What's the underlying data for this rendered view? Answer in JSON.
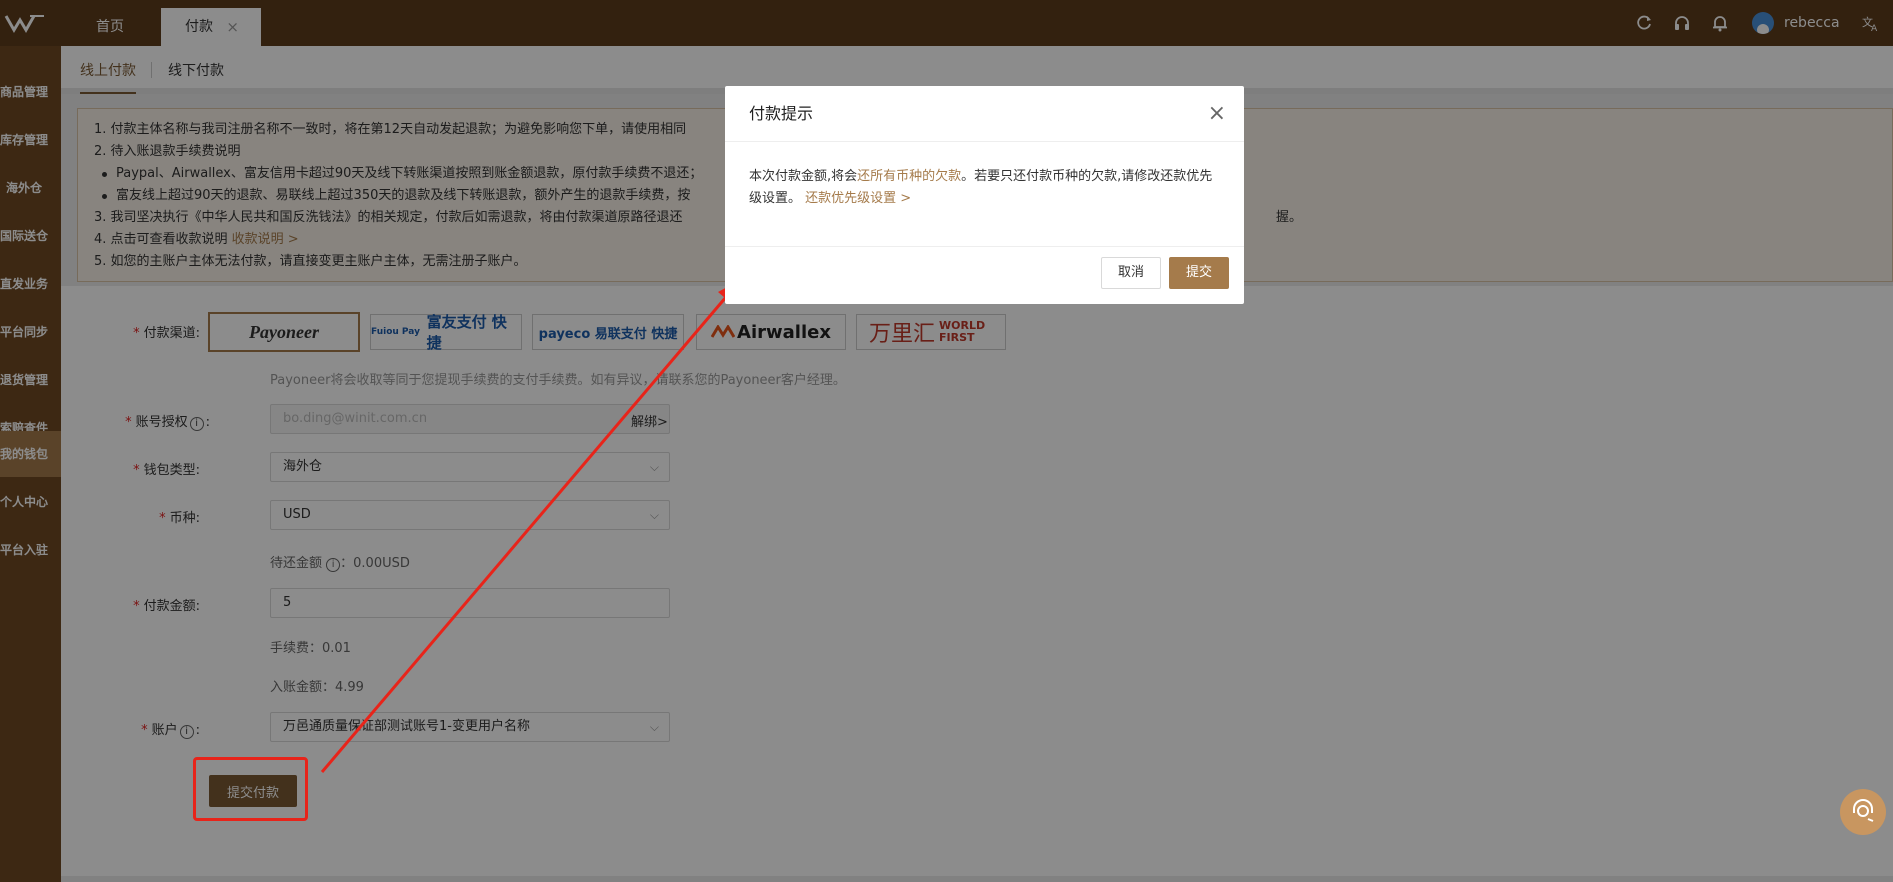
{
  "header": {
    "tabs": [
      {
        "label": "首页"
      },
      {
        "label": "付款",
        "close": "×"
      }
    ],
    "username": "rebecca"
  },
  "sidebar": {
    "items": [
      {
        "label": "商品管理"
      },
      {
        "label": "库存管理"
      },
      {
        "label": "海外仓"
      },
      {
        "label": "国际送仓"
      },
      {
        "label": "直发业务"
      },
      {
        "label": "平台同步"
      },
      {
        "label": "退货管理"
      },
      {
        "label": "索赔查件"
      },
      {
        "label": "我的钱包",
        "selected": true
      },
      {
        "label": "个人中心"
      },
      {
        "label": "平台入驻"
      }
    ]
  },
  "subtabs": [
    {
      "label": "线上付款",
      "active": true
    },
    {
      "label": "线下付款"
    }
  ],
  "notice": {
    "line1": "1. 付款主体名称与我司注册名称不一致时，将在第12天自动发起退款；为避免影响您下单，请使用相同",
    "line2": "2. 待入账退款手续费说明",
    "bullet1": "Paypal、Airwallex、富友信用卡超过90天及线下转账渠道按照到账金额退款，原付款手续费不退还；",
    "bullet2": "富友线上超过90天的退款、易联线上超过350天的退款及线下转账退款，额外产生的退款手续费，按",
    "line3": "3. 我司坚决执行《中华人民共和国反洗钱法》的相关规定，付款后如需退款，将由付款渠道原路径退还",
    "line3_tail": "握。",
    "line4_prefix": "4. 点击可查看收款说明 ",
    "line4_link": "收款说明 >",
    "line5": "5. 如您的主账户主体无法付款，请直接变更主账户主体，无需注册子账户。"
  },
  "form": {
    "channel_label": "付款渠道:",
    "channels": [
      {
        "name": "Payoneer",
        "selected": true
      },
      {
        "name": "富友支付 快捷",
        "sub": "Fuiou Pay"
      },
      {
        "name": "payeco 易联支付 快捷"
      },
      {
        "name": "Airwallex"
      },
      {
        "name": "万里汇",
        "sub": "WORLD FIRST"
      }
    ],
    "channel_note": "Payoneer将会收取等同于您提现手续费的支付手续费。如有异议，请联系您的Payoneer客户经理。",
    "account_auth_label": "账号授权",
    "account_auth_value": "bo.ding@winit.com.cn",
    "unbind_link": "解绑>",
    "wallet_type_label": "钱包类型:",
    "wallet_type_value": "海外仓",
    "currency_label": "币种:",
    "currency_value": "USD",
    "pending_label": "待还金额",
    "pending_value": "：0.00USD",
    "amount_label": "付款金额:",
    "amount_value": "5",
    "fee_text": "手续费：0.01",
    "received_text": "入账金额：4.99",
    "account_label": "账户",
    "account_value": "万邑通质量保证部测试账号1-变更用户名称",
    "submit_label": "提交付款"
  },
  "modal": {
    "title": "付款提示",
    "close": "×",
    "body_prefix": "本次付款金额,将会",
    "body_highlight": "还所有币种的欠款",
    "body_mid": "。若要只还付款币种的欠款,请修改还款优先级设置。",
    "body_link": "还款优先级设置 >",
    "cancel_label": "取消",
    "ok_label": "提交"
  },
  "colors": {
    "brand": "#5e3c1c",
    "accent": "#a57b4b",
    "annotation": "#e8241a"
  }
}
